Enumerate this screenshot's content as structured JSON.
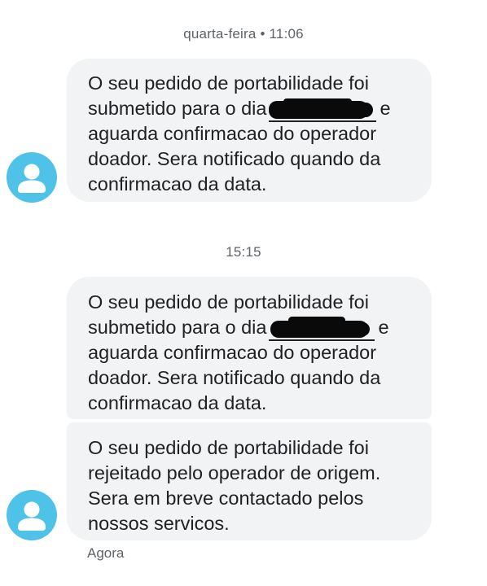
{
  "conversation": {
    "timestamps": [
      "quarta-feira • 11:06",
      "15:15"
    ],
    "messages": [
      {
        "line1": "O seu pedido de portabilidade foi",
        "line2_before": "submetido para o dia",
        "line2_after": "e",
        "line3": "aguarda confirmacao do operador",
        "line4": "doador. Sera notificado quando da",
        "line5": "confirmacao da data."
      },
      {
        "line1": "O seu pedido de portabilidade foi",
        "line2_before": "submetido para o dia",
        "line2_after": "e",
        "line3": "aguarda confirmacao do operador",
        "line4": "doador. Sera notificado quando da",
        "line5": "confirmacao da data."
      },
      {
        "line1": "O seu pedido de portabilidade foi",
        "line2": "rejeitado pelo operador de origem.",
        "line3": "Sera em breve contactado pelos",
        "line4": "nossos servicos."
      }
    ],
    "status": "Agora"
  },
  "icons": {
    "avatar": "person-icon"
  },
  "colors": {
    "bubble": "#f1f3f4",
    "avatar": "#4fc3e7",
    "meta_text": "#5f6368",
    "message_text": "#202124",
    "redaction": "#0a0a0a"
  }
}
